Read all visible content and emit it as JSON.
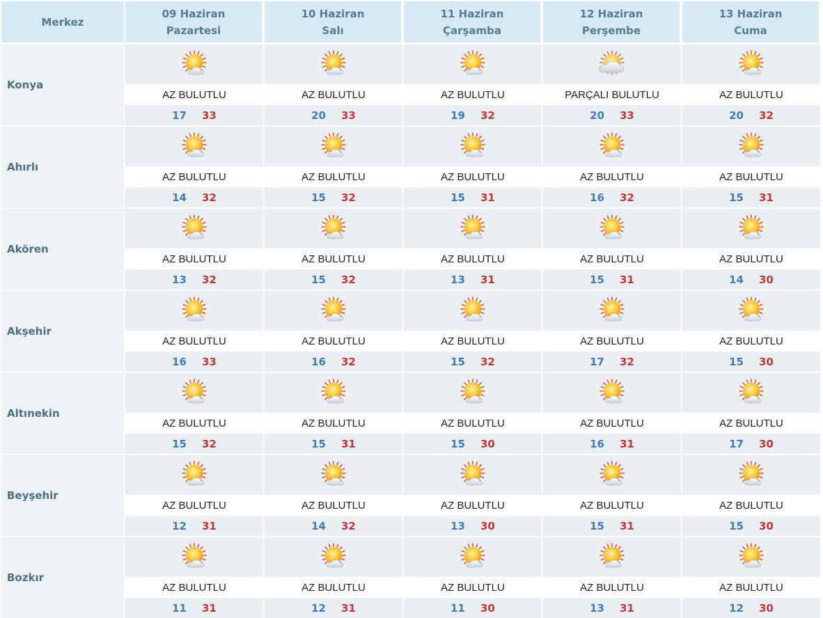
{
  "header": {
    "merkez_label": "Merkez",
    "days": [
      {
        "date": "09 Haziran",
        "weekday": "Pazartesi"
      },
      {
        "date": "10 Haziran",
        "weekday": "Salı"
      },
      {
        "date": "11 Haziran",
        "weekday": "Çarşamba"
      },
      {
        "date": "12 Haziran",
        "weekday": "Perşembe"
      },
      {
        "date": "13 Haziran",
        "weekday": "Cuma"
      }
    ]
  },
  "colors": {
    "header_bg": "#d6e9f2",
    "min_temp": "#3f7bbd",
    "max_temp": "#c8343a",
    "row_bg": "#e9eef1"
  },
  "cities": [
    {
      "name": "Konya",
      "days": [
        {
          "icon": "partly-sunny-icon",
          "condition": "AZ BULUTLU",
          "min": "17",
          "max": "33"
        },
        {
          "icon": "partly-sunny-icon",
          "condition": "AZ BULUTLU",
          "min": "20",
          "max": "33"
        },
        {
          "icon": "partly-sunny-icon",
          "condition": "AZ BULUTLU",
          "min": "19",
          "max": "32"
        },
        {
          "icon": "partly-cloudy-icon",
          "condition": "PARÇALI BULUTLU",
          "min": "20",
          "max": "33"
        },
        {
          "icon": "partly-sunny-icon",
          "condition": "AZ BULUTLU",
          "min": "20",
          "max": "32"
        }
      ]
    },
    {
      "name": "Ahırlı",
      "days": [
        {
          "icon": "partly-sunny-icon",
          "condition": "AZ BULUTLU",
          "min": "14",
          "max": "32"
        },
        {
          "icon": "partly-sunny-icon",
          "condition": "AZ BULUTLU",
          "min": "15",
          "max": "32"
        },
        {
          "icon": "partly-sunny-icon",
          "condition": "AZ BULUTLU",
          "min": "15",
          "max": "31"
        },
        {
          "icon": "partly-sunny-icon",
          "condition": "AZ BULUTLU",
          "min": "16",
          "max": "32"
        },
        {
          "icon": "partly-sunny-icon",
          "condition": "AZ BULUTLU",
          "min": "15",
          "max": "31"
        }
      ]
    },
    {
      "name": "Akören",
      "days": [
        {
          "icon": "partly-sunny-icon",
          "condition": "AZ BULUTLU",
          "min": "13",
          "max": "32"
        },
        {
          "icon": "partly-sunny-icon",
          "condition": "AZ BULUTLU",
          "min": "15",
          "max": "32"
        },
        {
          "icon": "partly-sunny-icon",
          "condition": "AZ BULUTLU",
          "min": "13",
          "max": "31"
        },
        {
          "icon": "partly-sunny-icon",
          "condition": "AZ BULUTLU",
          "min": "15",
          "max": "31"
        },
        {
          "icon": "partly-sunny-icon",
          "condition": "AZ BULUTLU",
          "min": "14",
          "max": "30"
        }
      ]
    },
    {
      "name": "Akşehir",
      "days": [
        {
          "icon": "partly-sunny-icon",
          "condition": "AZ BULUTLU",
          "min": "16",
          "max": "33"
        },
        {
          "icon": "partly-sunny-icon",
          "condition": "AZ BULUTLU",
          "min": "16",
          "max": "32"
        },
        {
          "icon": "partly-sunny-icon",
          "condition": "AZ BULUTLU",
          "min": "15",
          "max": "32"
        },
        {
          "icon": "partly-sunny-icon",
          "condition": "AZ BULUTLU",
          "min": "17",
          "max": "32"
        },
        {
          "icon": "partly-sunny-icon",
          "condition": "AZ BULUTLU",
          "min": "15",
          "max": "30"
        }
      ]
    },
    {
      "name": "Altınekin",
      "days": [
        {
          "icon": "partly-sunny-icon",
          "condition": "AZ BULUTLU",
          "min": "15",
          "max": "32"
        },
        {
          "icon": "partly-sunny-icon",
          "condition": "AZ BULUTLU",
          "min": "15",
          "max": "31"
        },
        {
          "icon": "partly-sunny-icon",
          "condition": "AZ BULUTLU",
          "min": "15",
          "max": "30"
        },
        {
          "icon": "partly-sunny-icon",
          "condition": "AZ BULUTLU",
          "min": "16",
          "max": "31"
        },
        {
          "icon": "partly-sunny-icon",
          "condition": "AZ BULUTLU",
          "min": "17",
          "max": "30"
        }
      ]
    },
    {
      "name": "Beyşehir",
      "days": [
        {
          "icon": "partly-sunny-icon",
          "condition": "AZ BULUTLU",
          "min": "12",
          "max": "31"
        },
        {
          "icon": "partly-sunny-icon",
          "condition": "AZ BULUTLU",
          "min": "14",
          "max": "32"
        },
        {
          "icon": "partly-sunny-icon",
          "condition": "AZ BULUTLU",
          "min": "13",
          "max": "30"
        },
        {
          "icon": "partly-sunny-icon",
          "condition": "AZ BULUTLU",
          "min": "15",
          "max": "31"
        },
        {
          "icon": "partly-sunny-icon",
          "condition": "AZ BULUTLU",
          "min": "15",
          "max": "30"
        }
      ]
    },
    {
      "name": "Bozkır",
      "days": [
        {
          "icon": "partly-sunny-icon",
          "condition": "AZ BULUTLU",
          "min": "11",
          "max": "31"
        },
        {
          "icon": "partly-sunny-icon",
          "condition": "AZ BULUTLU",
          "min": "12",
          "max": "31"
        },
        {
          "icon": "partly-sunny-icon",
          "condition": "AZ BULUTLU",
          "min": "11",
          "max": "30"
        },
        {
          "icon": "partly-sunny-icon",
          "condition": "AZ BULUTLU",
          "min": "13",
          "max": "31"
        },
        {
          "icon": "partly-sunny-icon",
          "condition": "AZ BULUTLU",
          "min": "12",
          "max": "30"
        }
      ]
    }
  ]
}
